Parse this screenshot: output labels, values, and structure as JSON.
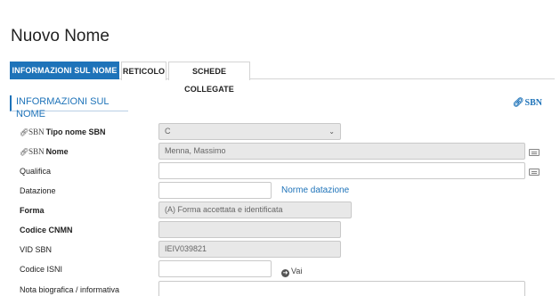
{
  "page": {
    "title": "Nuovo Nome"
  },
  "tabs": [
    {
      "label": "INFORMAZIONI SUL NOME",
      "active": true
    },
    {
      "label": "RETICOLO",
      "active": false
    },
    {
      "label": "SCHEDE COLLEGATE",
      "active": false
    }
  ],
  "section": {
    "title": "INFORMAZIONI SUL NOME",
    "sbn_link": "SBN",
    "sbn_icon": "chain-link-icon"
  },
  "form": {
    "sbn_prefix": "SBN",
    "tipo_nome": {
      "label": "Tipo nome SBN",
      "value": "C"
    },
    "nome": {
      "label": "Nome",
      "value": "Menna, Massimo"
    },
    "qualifica": {
      "label": "Qualifica",
      "value": ""
    },
    "datazione": {
      "label": "Datazione",
      "value": "",
      "link": "Norme datazione"
    },
    "forma": {
      "label": "Forma",
      "value": "(A) Forma accettata e identificata"
    },
    "codice_cnmn": {
      "label": "Codice CNMN",
      "value": ""
    },
    "vid_sbn": {
      "label": "VID SBN",
      "value": "IEIV039821"
    },
    "codice_isni": {
      "label": "Codice ISNI",
      "value": "",
      "go_label": "Vai"
    },
    "nota_biografica": {
      "label": "Nota biografica / informativa",
      "value": ""
    }
  },
  "colors": {
    "accent": "#1e73b9",
    "disabled_bg": "#e8e8e8"
  }
}
